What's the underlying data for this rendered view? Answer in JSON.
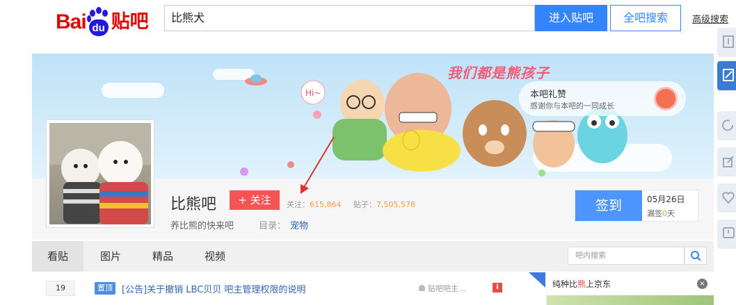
{
  "header": {
    "logo_text_bai": "Bai",
    "logo_text_du": "du",
    "logo_text_tieba": "贴吧",
    "search_value": "比熊犬",
    "enter_button": "进入贴吧",
    "all_search_button": "全吧搜索",
    "advanced_search_link": "高级搜索"
  },
  "banner": {
    "headline": "我们都是熊孩子",
    "praise_title": "本吧礼赞",
    "praise_subtitle": "感谢你与本吧的一同成长",
    "hi_text": "Hi~"
  },
  "forum": {
    "name": "比熊吧",
    "follow_button": "+ 关注",
    "followers_label": "关注：",
    "followers_count": "615,864",
    "posts_label": "贴子：",
    "posts_count": "7,505,578",
    "slogan": "养比熊的快来吧",
    "catalog_label": "目录：",
    "catalog_value": "宠物"
  },
  "signin": {
    "button": "签到",
    "date": "05月26日",
    "streak_prefix": "漏签",
    "streak_count": "0",
    "streak_suffix": "天"
  },
  "tabs": [
    {
      "label": "看贴",
      "active": true
    },
    {
      "label": "图片",
      "active": false
    },
    {
      "label": "精品",
      "active": false
    },
    {
      "label": "视频",
      "active": false
    }
  ],
  "inner_search": {
    "placeholder": "吧内搜索"
  },
  "posts": [
    {
      "reply_count": "19",
      "badge": "置顶",
      "title": "[公告]关于撤销 LBC贝贝 吧主管理权限的说明",
      "author": "贴吧吧主..."
    }
  ],
  "ad": {
    "title_prefix": "纯种比",
    "title_highlight": "熊",
    "title_suffix": "上京东"
  },
  "colors": {
    "accent_blue": "#3385ff",
    "follow_red": "#f55354",
    "link_blue": "#2d64b3",
    "stat_orange": "#f29945"
  }
}
